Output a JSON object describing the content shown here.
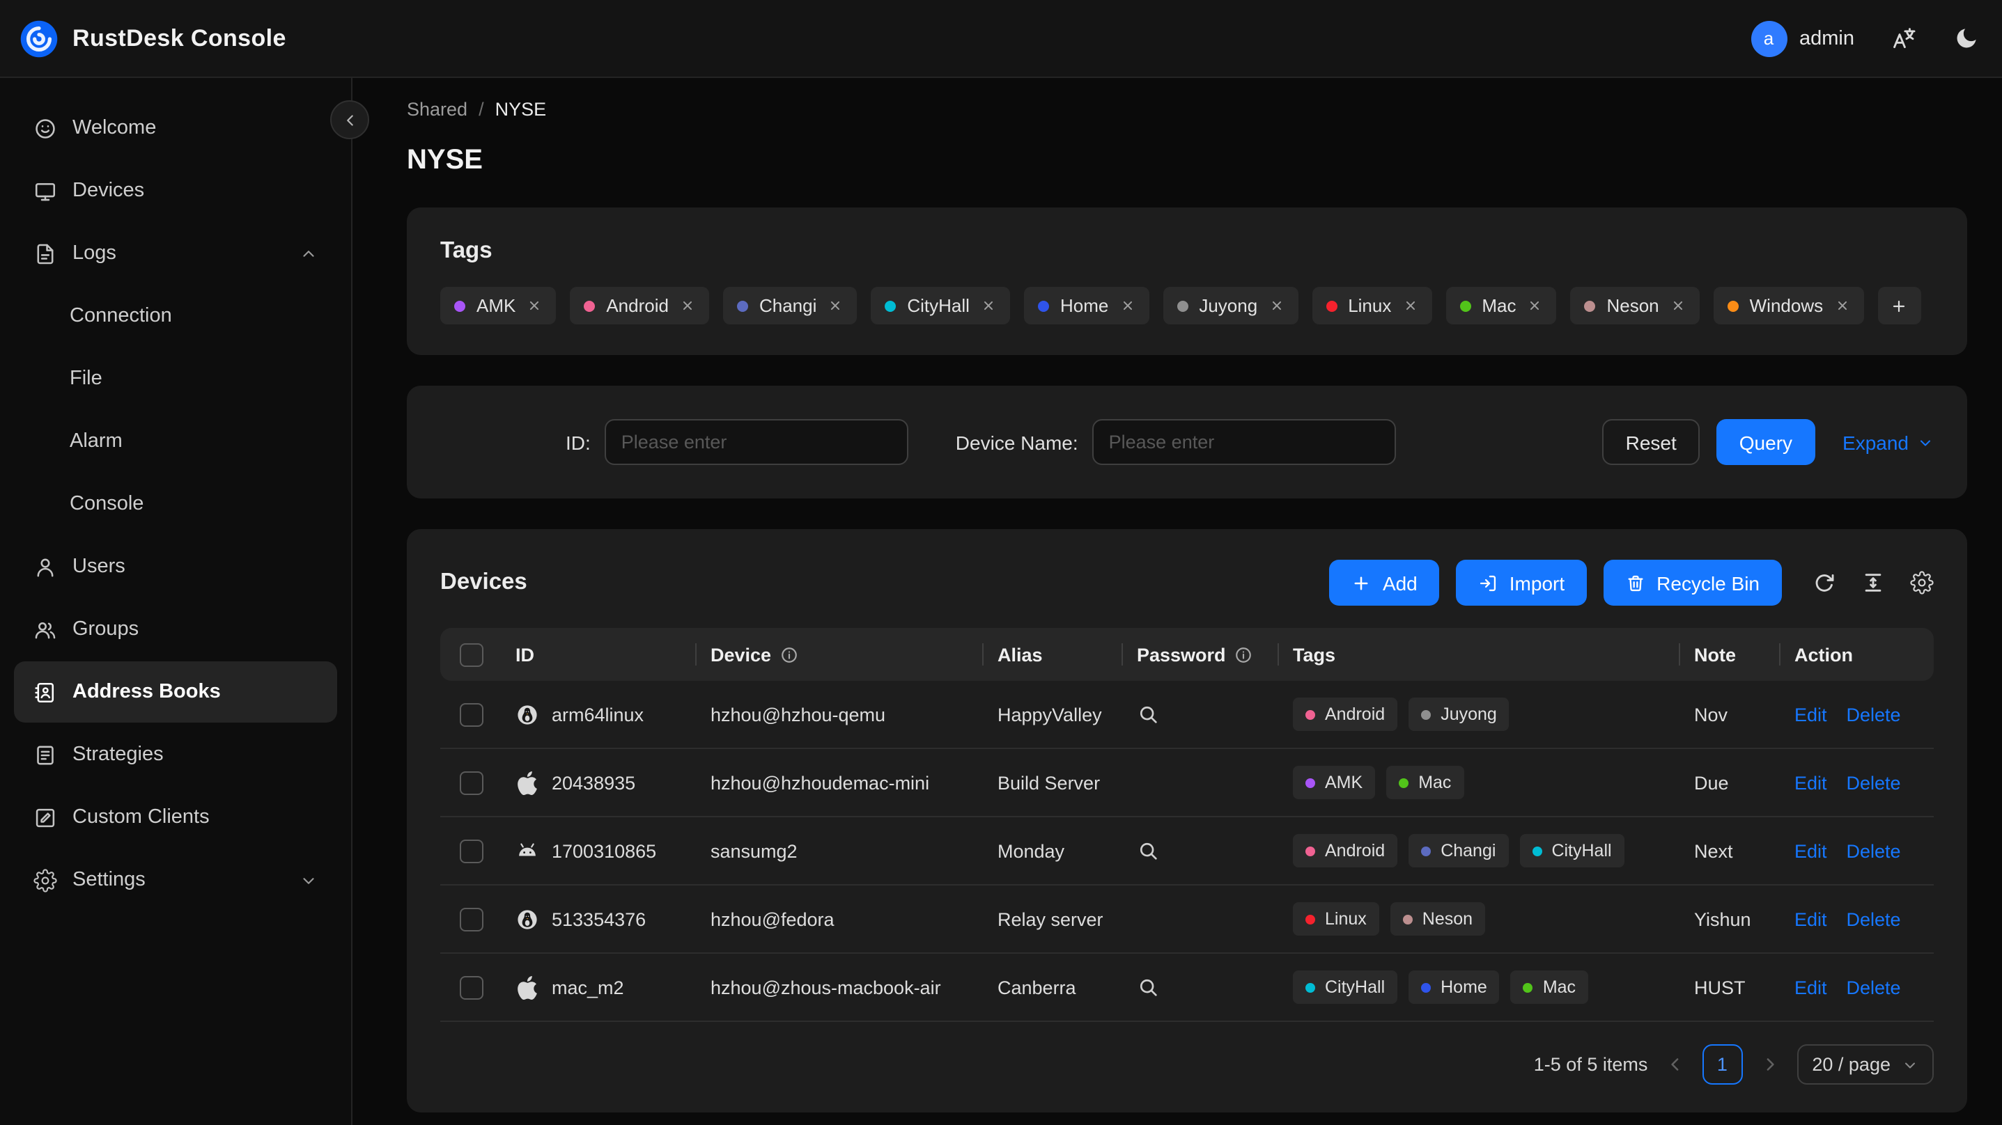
{
  "header": {
    "app_title": "RustDesk Console",
    "avatar_letter": "a",
    "username": "admin"
  },
  "sidebar": {
    "items": [
      {
        "label": "Welcome",
        "icon": "smile-icon"
      },
      {
        "label": "Devices",
        "icon": "monitor-icon"
      },
      {
        "label": "Logs",
        "icon": "file-icon",
        "expanded": true,
        "chevron": "up",
        "children": [
          {
            "label": "Connection"
          },
          {
            "label": "File"
          },
          {
            "label": "Alarm"
          },
          {
            "label": "Console"
          }
        ]
      },
      {
        "label": "Users",
        "icon": "user-icon"
      },
      {
        "label": "Groups",
        "icon": "team-icon"
      },
      {
        "label": "Address Books",
        "icon": "contacts-icon",
        "selected": true
      },
      {
        "label": "Strategies",
        "icon": "strategy-icon"
      },
      {
        "label": "Custom Clients",
        "icon": "edit-square-icon"
      },
      {
        "label": "Settings",
        "icon": "gear-icon",
        "chevron": "down"
      }
    ]
  },
  "breadcrumb": {
    "items": [
      "Shared",
      "NYSE"
    ],
    "separator": "/"
  },
  "page_title": "NYSE",
  "tag_colors": {
    "AMK": "#a855f7",
    "Android": "#f06292",
    "Changi": "#5c6bc0",
    "CityHall": "#00bcd4",
    "Home": "#2f54eb",
    "Juyong": "#8f8f8f",
    "Linux": "#f5222d",
    "Mac": "#52c41a",
    "Neson": "#bc8f8f",
    "Windows": "#fa8c16"
  },
  "tags_card": {
    "title": "Tags",
    "tags": [
      "AMK",
      "Android",
      "Changi",
      "CityHall",
      "Home",
      "Juyong",
      "Linux",
      "Mac",
      "Neson",
      "Windows"
    ]
  },
  "filter": {
    "id_label": "ID:",
    "id_placeholder": "Please enter",
    "device_name_label": "Device Name:",
    "device_name_placeholder": "Please enter",
    "reset_button": "Reset",
    "query_button": "Query",
    "expand_link": "Expand"
  },
  "devices": {
    "title": "Devices",
    "add_button": "Add",
    "import_button": "Import",
    "recycle_bin_button": "Recycle Bin",
    "columns": {
      "id": "ID",
      "device": "Device",
      "alias": "Alias",
      "password": "Password",
      "tags": "Tags",
      "note": "Note",
      "action": "Action"
    },
    "edit_label": "Edit",
    "delete_label": "Delete",
    "rows": [
      {
        "os": "linux",
        "id": "arm64linux",
        "device": "hzhou@hzhou-qemu",
        "alias": "HappyValley",
        "password_reveal": true,
        "tags": [
          "Android",
          "Juyong"
        ],
        "note": "Nov"
      },
      {
        "os": "apple",
        "id": "20438935",
        "device": "hzhou@hzhoudemac-mini",
        "alias": "Build Server",
        "password_reveal": false,
        "tags": [
          "AMK",
          "Mac"
        ],
        "note": "Due"
      },
      {
        "os": "android",
        "id": "1700310865",
        "device": "sansumg2",
        "alias": "Monday",
        "password_reveal": true,
        "tags": [
          "Android",
          "Changi",
          "CityHall"
        ],
        "note": "Next"
      },
      {
        "os": "linux",
        "id": "513354376",
        "device": "hzhou@fedora",
        "alias": "Relay server",
        "password_reveal": false,
        "tags": [
          "Linux",
          "Neson"
        ],
        "note": "Yishun"
      },
      {
        "os": "apple",
        "id": "mac_m2",
        "device": "hzhou@zhous-macbook-air",
        "alias": "Canberra",
        "password_reveal": true,
        "tags": [
          "CityHall",
          "Home",
          "Mac"
        ],
        "note": "HUST"
      }
    ],
    "pagination": {
      "summary": "1-5 of 5 items",
      "current_page": "1",
      "page_size": "20 / page"
    }
  },
  "colors": {
    "accent": "#1677ff"
  }
}
